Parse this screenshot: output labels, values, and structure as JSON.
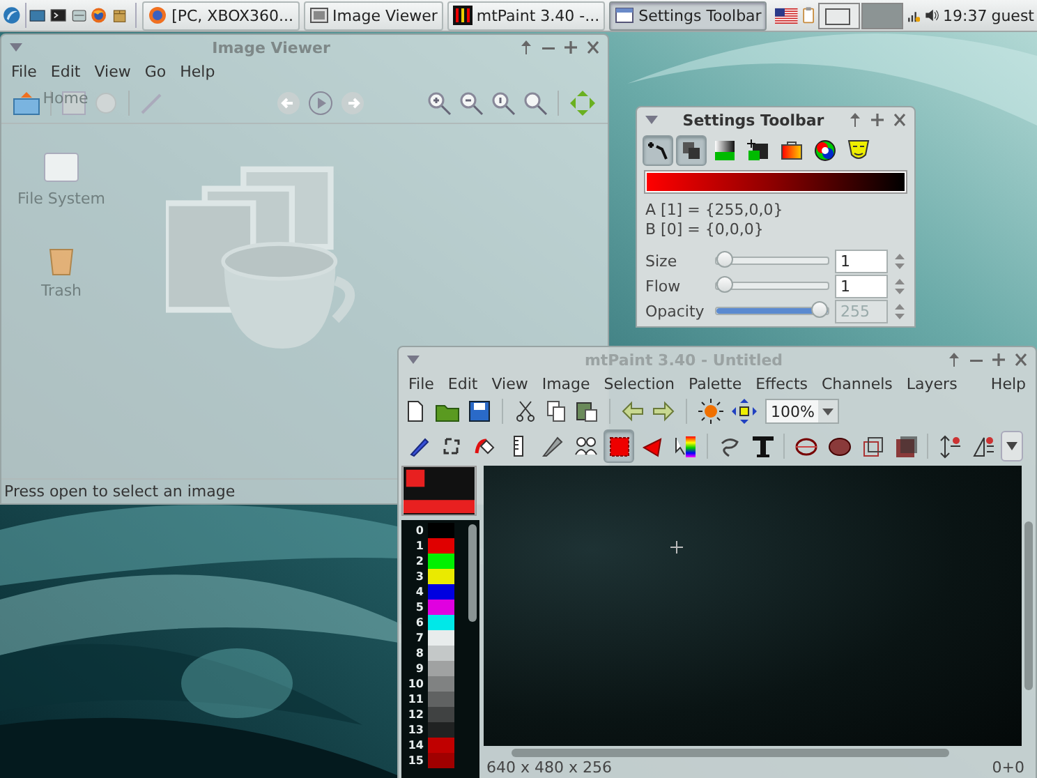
{
  "taskbar": {
    "tasks": [
      {
        "label": "[PC, XBOX360...",
        "selected": false
      },
      {
        "label": "Image Viewer",
        "selected": false
      },
      {
        "label": "mtPaint 3.40 -...",
        "selected": false
      },
      {
        "label": "Settings Toolbar",
        "selected": true
      }
    ],
    "clock": "19:37",
    "user": "guest"
  },
  "desktop_icons": [
    {
      "label": "Home"
    },
    {
      "label": "File System"
    },
    {
      "label": "Trash"
    }
  ],
  "image_viewer": {
    "title": "Image Viewer",
    "menu": [
      "File",
      "Edit",
      "View",
      "Go",
      "Help"
    ],
    "status": "Press open to select an image"
  },
  "settings_toolbar": {
    "title": "Settings Toolbar",
    "tools": [
      {
        "selected": true
      },
      {
        "selected": true
      },
      {
        "selected": false
      },
      {
        "selected": false
      },
      {
        "selected": false
      },
      {
        "selected": false
      },
      {
        "selected": false
      }
    ],
    "color_a": "A [1] = {255,0,0}",
    "color_b": "B [0] = {0,0,0}",
    "sliders": [
      {
        "label": "Size",
        "value": "1",
        "level": 0,
        "disabled": false
      },
      {
        "label": "Flow",
        "value": "1",
        "level": 0,
        "disabled": false
      },
      {
        "label": "Opacity",
        "value": "255",
        "level": 1,
        "disabled": true
      }
    ]
  },
  "mtpaint": {
    "title": "mtPaint 3.40 - Untitled",
    "menu": [
      "File",
      "Edit",
      "View",
      "Image",
      "Selection",
      "Palette",
      "Effects",
      "Channels",
      "Layers",
      "Help"
    ],
    "zoom": "100%",
    "tools": [
      {
        "selected": false
      },
      {
        "selected": false
      },
      {
        "selected": false
      },
      {
        "selected": false
      },
      {
        "selected": false
      },
      {
        "selected": false
      },
      {
        "selected": true
      },
      {
        "selected": false
      },
      {
        "selected": false
      },
      {
        "selected": false
      },
      {
        "selected": false
      },
      {
        "selected": false
      },
      {
        "selected": false
      },
      {
        "selected": false
      },
      {
        "selected": false
      },
      {
        "selected": false
      },
      {
        "selected": false
      }
    ],
    "palette": [
      {
        "index": "0",
        "color": "#000000"
      },
      {
        "index": "1",
        "color": "#e00000"
      },
      {
        "index": "2",
        "color": "#00f000"
      },
      {
        "index": "3",
        "color": "#eaea00"
      },
      {
        "index": "4",
        "color": "#0000e0"
      },
      {
        "index": "5",
        "color": "#e000e0"
      },
      {
        "index": "6",
        "color": "#00e8e8"
      },
      {
        "index": "7",
        "color": "#e8ecec"
      },
      {
        "index": "8",
        "color": "#c4c8c8"
      },
      {
        "index": "9",
        "color": "#a0a2a2"
      },
      {
        "index": "10",
        "color": "#808282"
      },
      {
        "index": "11",
        "color": "#606262"
      },
      {
        "index": "12",
        "color": "#404242"
      },
      {
        "index": "13",
        "color": "#202222"
      },
      {
        "index": "14",
        "color": "#c00000"
      },
      {
        "index": "15",
        "color": "#a00000"
      }
    ],
    "status_left": "640 x 480 x 256",
    "status_right": "0+0"
  }
}
